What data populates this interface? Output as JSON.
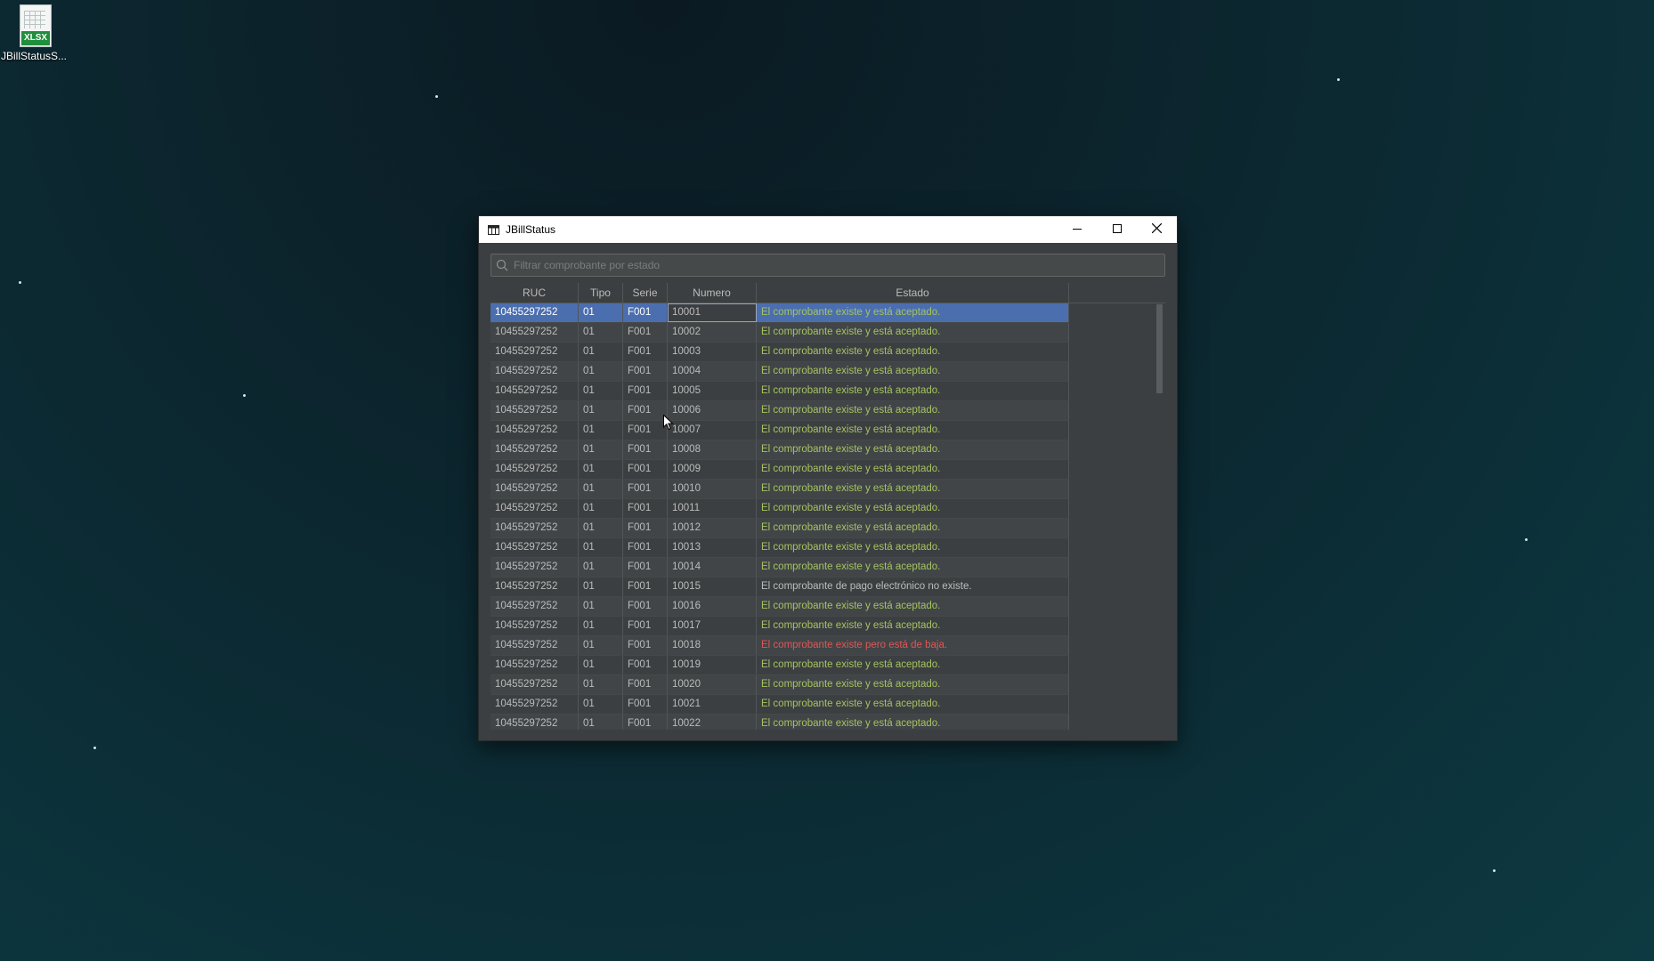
{
  "desktop": {
    "icon": {
      "badge": "XLSX",
      "label": "JBillStatusS..."
    }
  },
  "window": {
    "title": "JBillStatus",
    "controls": {
      "minimize": "minimize-icon",
      "maximize": "maximize-icon",
      "close": "close-icon"
    }
  },
  "search": {
    "placeholder": "Filtrar comprobante por estado",
    "value": ""
  },
  "table": {
    "columns": [
      "RUC",
      "Tipo",
      "Serie",
      "Numero",
      "Estado"
    ],
    "rows": [
      {
        "ruc": "10455297252",
        "tipo": "01",
        "serie": "F001",
        "numero": "10001",
        "estado": "El comprobante existe y está aceptado.",
        "status": "ok",
        "selected": true
      },
      {
        "ruc": "10455297252",
        "tipo": "01",
        "serie": "F001",
        "numero": "10002",
        "estado": "El comprobante existe y está aceptado.",
        "status": "ok"
      },
      {
        "ruc": "10455297252",
        "tipo": "01",
        "serie": "F001",
        "numero": "10003",
        "estado": "El comprobante existe y está aceptado.",
        "status": "ok"
      },
      {
        "ruc": "10455297252",
        "tipo": "01",
        "serie": "F001",
        "numero": "10004",
        "estado": "El comprobante existe y está aceptado.",
        "status": "ok"
      },
      {
        "ruc": "10455297252",
        "tipo": "01",
        "serie": "F001",
        "numero": "10005",
        "estado": "El comprobante existe y está aceptado.",
        "status": "ok"
      },
      {
        "ruc": "10455297252",
        "tipo": "01",
        "serie": "F001",
        "numero": "10006",
        "estado": "El comprobante existe y está aceptado.",
        "status": "ok"
      },
      {
        "ruc": "10455297252",
        "tipo": "01",
        "serie": "F001",
        "numero": "10007",
        "estado": "El comprobante existe y está aceptado.",
        "status": "ok"
      },
      {
        "ruc": "10455297252",
        "tipo": "01",
        "serie": "F001",
        "numero": "10008",
        "estado": "El comprobante existe y está aceptado.",
        "status": "ok"
      },
      {
        "ruc": "10455297252",
        "tipo": "01",
        "serie": "F001",
        "numero": "10009",
        "estado": "El comprobante existe y está aceptado.",
        "status": "ok"
      },
      {
        "ruc": "10455297252",
        "tipo": "01",
        "serie": "F001",
        "numero": "10010",
        "estado": "El comprobante existe y está aceptado.",
        "status": "ok"
      },
      {
        "ruc": "10455297252",
        "tipo": "01",
        "serie": "F001",
        "numero": "10011",
        "estado": "El comprobante existe y está aceptado.",
        "status": "ok"
      },
      {
        "ruc": "10455297252",
        "tipo": "01",
        "serie": "F001",
        "numero": "10012",
        "estado": "El comprobante existe y está aceptado.",
        "status": "ok"
      },
      {
        "ruc": "10455297252",
        "tipo": "01",
        "serie": "F001",
        "numero": "10013",
        "estado": "El comprobante existe y está aceptado.",
        "status": "ok"
      },
      {
        "ruc": "10455297252",
        "tipo": "01",
        "serie": "F001",
        "numero": "10014",
        "estado": "El comprobante existe y está aceptado.",
        "status": "ok"
      },
      {
        "ruc": "10455297252",
        "tipo": "01",
        "serie": "F001",
        "numero": "10015",
        "estado": "El comprobante de pago electrónico no existe.",
        "status": "none"
      },
      {
        "ruc": "10455297252",
        "tipo": "01",
        "serie": "F001",
        "numero": "10016",
        "estado": "El comprobante existe y está aceptado.",
        "status": "ok"
      },
      {
        "ruc": "10455297252",
        "tipo": "01",
        "serie": "F001",
        "numero": "10017",
        "estado": "El comprobante existe y está aceptado.",
        "status": "ok"
      },
      {
        "ruc": "10455297252",
        "tipo": "01",
        "serie": "F001",
        "numero": "10018",
        "estado": "El comprobante existe pero está de baja.",
        "status": "baja"
      },
      {
        "ruc": "10455297252",
        "tipo": "01",
        "serie": "F001",
        "numero": "10019",
        "estado": "El comprobante existe y está aceptado.",
        "status": "ok"
      },
      {
        "ruc": "10455297252",
        "tipo": "01",
        "serie": "F001",
        "numero": "10020",
        "estado": "El comprobante existe y está aceptado.",
        "status": "ok"
      },
      {
        "ruc": "10455297252",
        "tipo": "01",
        "serie": "F001",
        "numero": "10021",
        "estado": "El comprobante existe y está aceptado.",
        "status": "ok"
      },
      {
        "ruc": "10455297252",
        "tipo": "01",
        "serie": "F001",
        "numero": "10022",
        "estado": "El comprobante existe y está aceptado.",
        "status": "ok"
      }
    ]
  },
  "colors": {
    "accepted": "#a5c261",
    "not_exists": "#bbbbbb",
    "baja": "#e05555",
    "selection": "#4b6eaf"
  }
}
